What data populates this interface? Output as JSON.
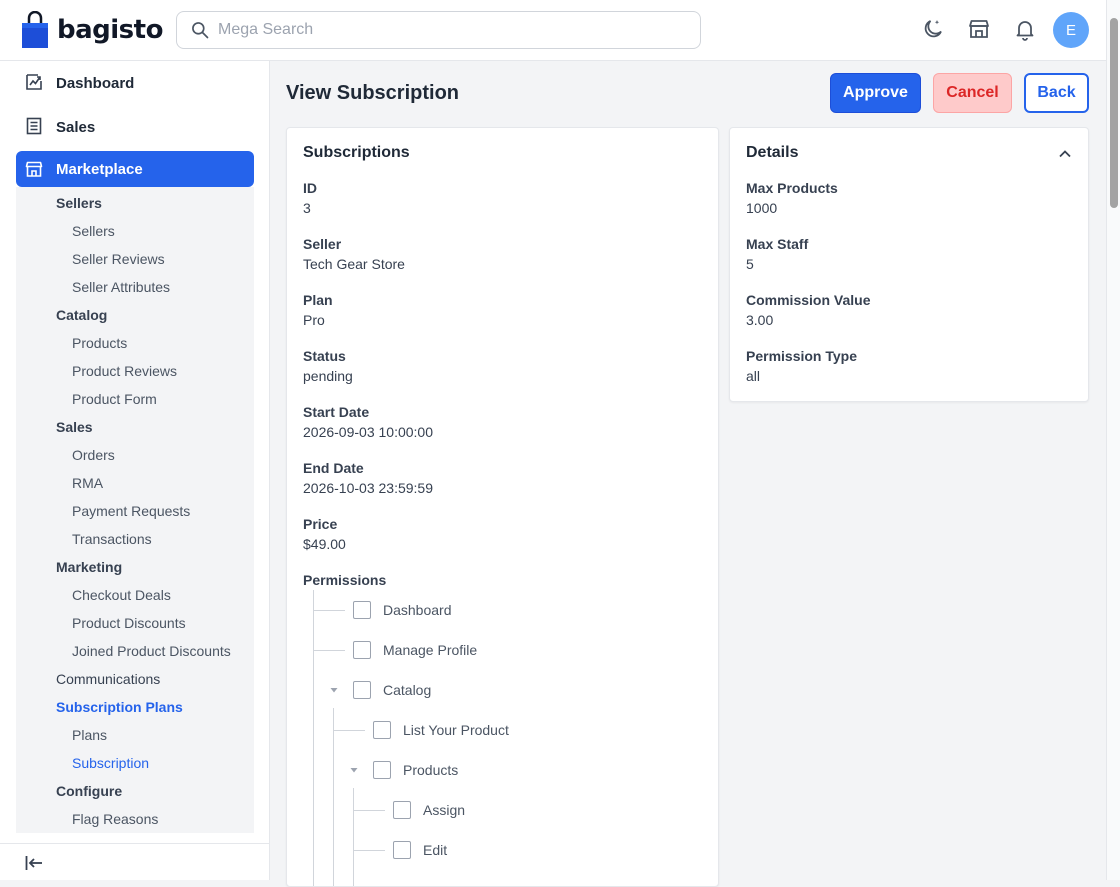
{
  "header": {
    "logo_text": "bagisto",
    "search_placeholder": "Mega Search",
    "avatar_initial": "E"
  },
  "sidebar": {
    "main": [
      {
        "label": "Dashboard"
      },
      {
        "label": "Sales"
      },
      {
        "label": "Marketplace"
      }
    ],
    "submenu": [
      {
        "label": "Sellers",
        "level": 1
      },
      {
        "label": "Sellers",
        "level": 2
      },
      {
        "label": "Seller Reviews",
        "level": 2
      },
      {
        "label": "Seller Attributes",
        "level": 2
      },
      {
        "label": "Catalog",
        "level": 1
      },
      {
        "label": "Products",
        "level": 2
      },
      {
        "label": "Product Reviews",
        "level": 2
      },
      {
        "label": "Product Form",
        "level": 2
      },
      {
        "label": "Sales",
        "level": 1
      },
      {
        "label": "Orders",
        "level": 2
      },
      {
        "label": "RMA",
        "level": 2
      },
      {
        "label": "Payment Requests",
        "level": 2
      },
      {
        "label": "Transactions",
        "level": 2
      },
      {
        "label": "Marketing",
        "level": 1
      },
      {
        "label": "Checkout Deals",
        "level": 2
      },
      {
        "label": "Product Discounts",
        "level": 2
      },
      {
        "label": "Joined Product Discounts",
        "level": 2
      },
      {
        "label": "Communications",
        "level": 1
      },
      {
        "label": "Subscription Plans",
        "level": 1
      },
      {
        "label": "Plans",
        "level": 2
      },
      {
        "label": "Subscription",
        "level": 2
      },
      {
        "label": "Configure",
        "level": 1
      },
      {
        "label": "Flag Reasons",
        "level": 2
      }
    ]
  },
  "page": {
    "title": "View Subscription",
    "approve_label": "Approve",
    "cancel_label": "Cancel",
    "back_label": "Back"
  },
  "subscription": {
    "title": "Subscriptions",
    "fields": [
      {
        "label": "ID",
        "value": "3"
      },
      {
        "label": "Seller",
        "value": "Tech Gear Store"
      },
      {
        "label": "Plan",
        "value": "Pro"
      },
      {
        "label": "Status",
        "value": "pending"
      },
      {
        "label": "Start Date",
        "value": "2026-09-03 10:00:00"
      },
      {
        "label": "End Date",
        "value": "2026-10-03 23:59:59"
      },
      {
        "label": "Price",
        "value": "$49.00"
      }
    ],
    "permissions_label": "Permissions",
    "permissions": [
      {
        "label": "Dashboard",
        "checked": false
      },
      {
        "label": "Manage Profile",
        "checked": false
      },
      {
        "label": "Catalog",
        "checked": false,
        "expanded": true
      },
      {
        "label": "List Your Product",
        "checked": false
      },
      {
        "label": "Products",
        "checked": false,
        "expanded": true
      },
      {
        "label": "Assign",
        "checked": false
      },
      {
        "label": "Edit",
        "checked": false
      }
    ]
  },
  "details": {
    "title": "Details",
    "fields": [
      {
        "label": "Max Products",
        "value": "1000"
      },
      {
        "label": "Max Staff",
        "value": "5"
      },
      {
        "label": "Commission Value",
        "value": "3.00"
      },
      {
        "label": "Permission Type",
        "value": "all"
      }
    ]
  },
  "colors": {
    "primary": "#2563eb",
    "danger_bg": "#fecaca",
    "danger_text": "#dc2626"
  }
}
